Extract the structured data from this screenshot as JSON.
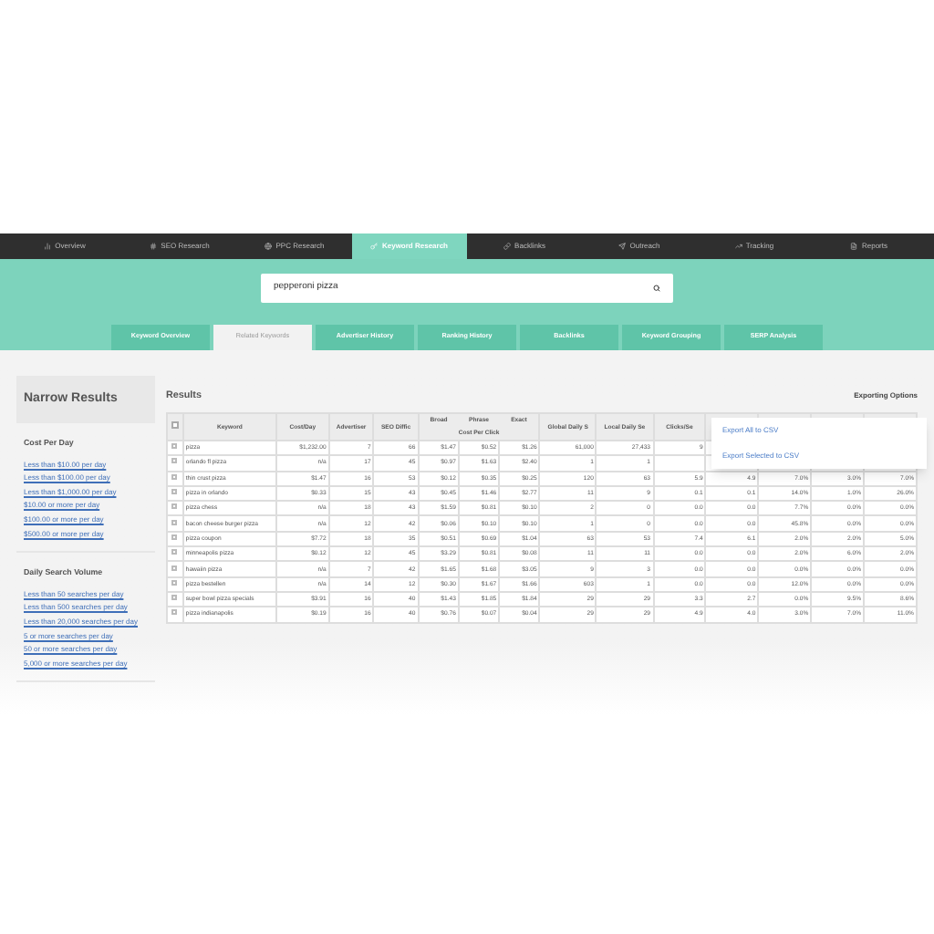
{
  "nav": [
    {
      "label": "Overview",
      "selected": false
    },
    {
      "label": "SEO Research",
      "selected": false
    },
    {
      "label": "PPC Research",
      "selected": false
    },
    {
      "label": "Keyword Research",
      "selected": true
    },
    {
      "label": "Backlinks",
      "selected": false
    },
    {
      "label": "Outreach",
      "selected": false
    },
    {
      "label": "Tracking",
      "selected": false
    },
    {
      "label": "Reports",
      "selected": false
    }
  ],
  "search": {
    "value": "pepperoni pizza"
  },
  "tabs": [
    {
      "label": "Keyword Overview",
      "selected": false
    },
    {
      "label": "Related Keywords",
      "selected": true
    },
    {
      "label": "Advertiser History",
      "selected": false
    },
    {
      "label": "Ranking History",
      "selected": false
    },
    {
      "label": "Backlinks",
      "selected": false
    },
    {
      "label": "Keyword Grouping",
      "selected": false
    },
    {
      "label": "SERP Analysis",
      "selected": false
    }
  ],
  "sidebar": {
    "title": "Narrow Results",
    "sections": [
      {
        "heading": "Cost Per Day",
        "links": [
          "Less than $10.00 per day",
          "Less than $100.00 per day",
          "Less than $1,000.00 per day",
          "$10.00 or more per day",
          "$100.00 or more per day",
          "$500.00 or more per day"
        ]
      },
      {
        "heading": "Daily Search Volume",
        "links": [
          "Less than 50 searches per day",
          "Less than 500 searches per day",
          "Less than 20,000 searches per day",
          "5 or more searches per day",
          "50 or more searches per day",
          "5,000 or more searches per day"
        ]
      }
    ]
  },
  "results": {
    "title": "Results",
    "exporting_options": "Exporting Options",
    "all_checked": false,
    "export_menu": [
      "Export All to CSV",
      "Export Selected to CSV"
    ],
    "columns": [
      "Keyword",
      "Cost/Day",
      "Advertiser",
      "SEO Diffic",
      "Broad",
      "Phrase",
      "Exact",
      "Global Daily S",
      "Local Daily Se",
      "Clicks/Se"
    ],
    "group_header": "Cost Per Click",
    "rows": [
      {
        "checked": false,
        "cells": [
          "pizza",
          "$1,232.00",
          "7",
          "66",
          "$1.47",
          "$0.52",
          "$1.26",
          "61,000",
          "27,433",
          "9"
        ]
      },
      {
        "checked": false,
        "cells": [
          "orlando fl pizza",
          "n/a",
          "17",
          "45",
          "$0.97",
          "$1.63",
          "$2.40",
          "1",
          "1"
        ]
      },
      {
        "checked": false,
        "cells": [
          "thin crust pizza",
          "$1.47",
          "16",
          "53",
          "$0.12",
          "$0.35",
          "$0.25",
          "120",
          "63",
          "5.9",
          "4.9",
          "7.0%",
          "3.0%",
          "7.0%"
        ]
      },
      {
        "checked": false,
        "cells": [
          "pizza in orlando",
          "$0.33",
          "15",
          "43",
          "$0.45",
          "$1.46",
          "$2.77",
          "11",
          "9",
          "0.1",
          "0.1",
          "14.0%",
          "1.0%",
          "26.0%"
        ]
      },
      {
        "checked": false,
        "cells": [
          "pizza chess",
          "n/a",
          "18",
          "43",
          "$1.59",
          "$0.81",
          "$0.10",
          "2",
          "0",
          "0.0",
          "0.0",
          "7.7%",
          "0.0%",
          "0.0%"
        ]
      },
      {
        "checked": false,
        "cells": [
          "bacon cheese burger pizza",
          "n/a",
          "12",
          "42",
          "$0.06",
          "$0.10",
          "$0.10",
          "1",
          "0",
          "0.0",
          "0.0",
          "45.8%",
          "0.0%",
          "0.0%"
        ]
      },
      {
        "checked": false,
        "cells": [
          "pizza coupon",
          "$7.72",
          "18",
          "35",
          "$0.51",
          "$0.69",
          "$1.04",
          "63",
          "53",
          "7.4",
          "6.1",
          "2.0%",
          "2.0%",
          "5.0%"
        ]
      },
      {
        "checked": false,
        "cells": [
          "minneapolis pizza",
          "$0.12",
          "12",
          "45",
          "$3.29",
          "$0.81",
          "$0.08",
          "11",
          "11",
          "0.0",
          "0.0",
          "2.0%",
          "6.0%",
          "2.0%"
        ]
      },
      {
        "checked": false,
        "cells": [
          "hawaiin pizza",
          "n/a",
          "7",
          "42",
          "$1.65",
          "$1.68",
          "$3.05",
          "9",
          "3",
          "0.0",
          "0.0",
          "0.0%",
          "0.0%",
          "0.0%"
        ]
      },
      {
        "checked": false,
        "cells": [
          "pizza bestellen",
          "n/a",
          "14",
          "12",
          "$0.30",
          "$1.67",
          "$1.66",
          "603",
          "1",
          "0.0",
          "0.0",
          "12.0%",
          "0.0%",
          "0.0%"
        ]
      },
      {
        "checked": false,
        "cells": [
          "super bowl pizza specials",
          "$3.91",
          "16",
          "40",
          "$1.43",
          "$1.85",
          "$1.84",
          "29",
          "29",
          "3.3",
          "2.7",
          "0.0%",
          "9.5%",
          "8.6%"
        ]
      },
      {
        "checked": false,
        "cells": [
          "pizza indianapolis",
          "$0.19",
          "16",
          "40",
          "$0.76",
          "$0.07",
          "$0.04",
          "29",
          "29",
          "4.9",
          "4.0",
          "3.0%",
          "7.0%",
          "11.0%"
        ]
      }
    ]
  }
}
